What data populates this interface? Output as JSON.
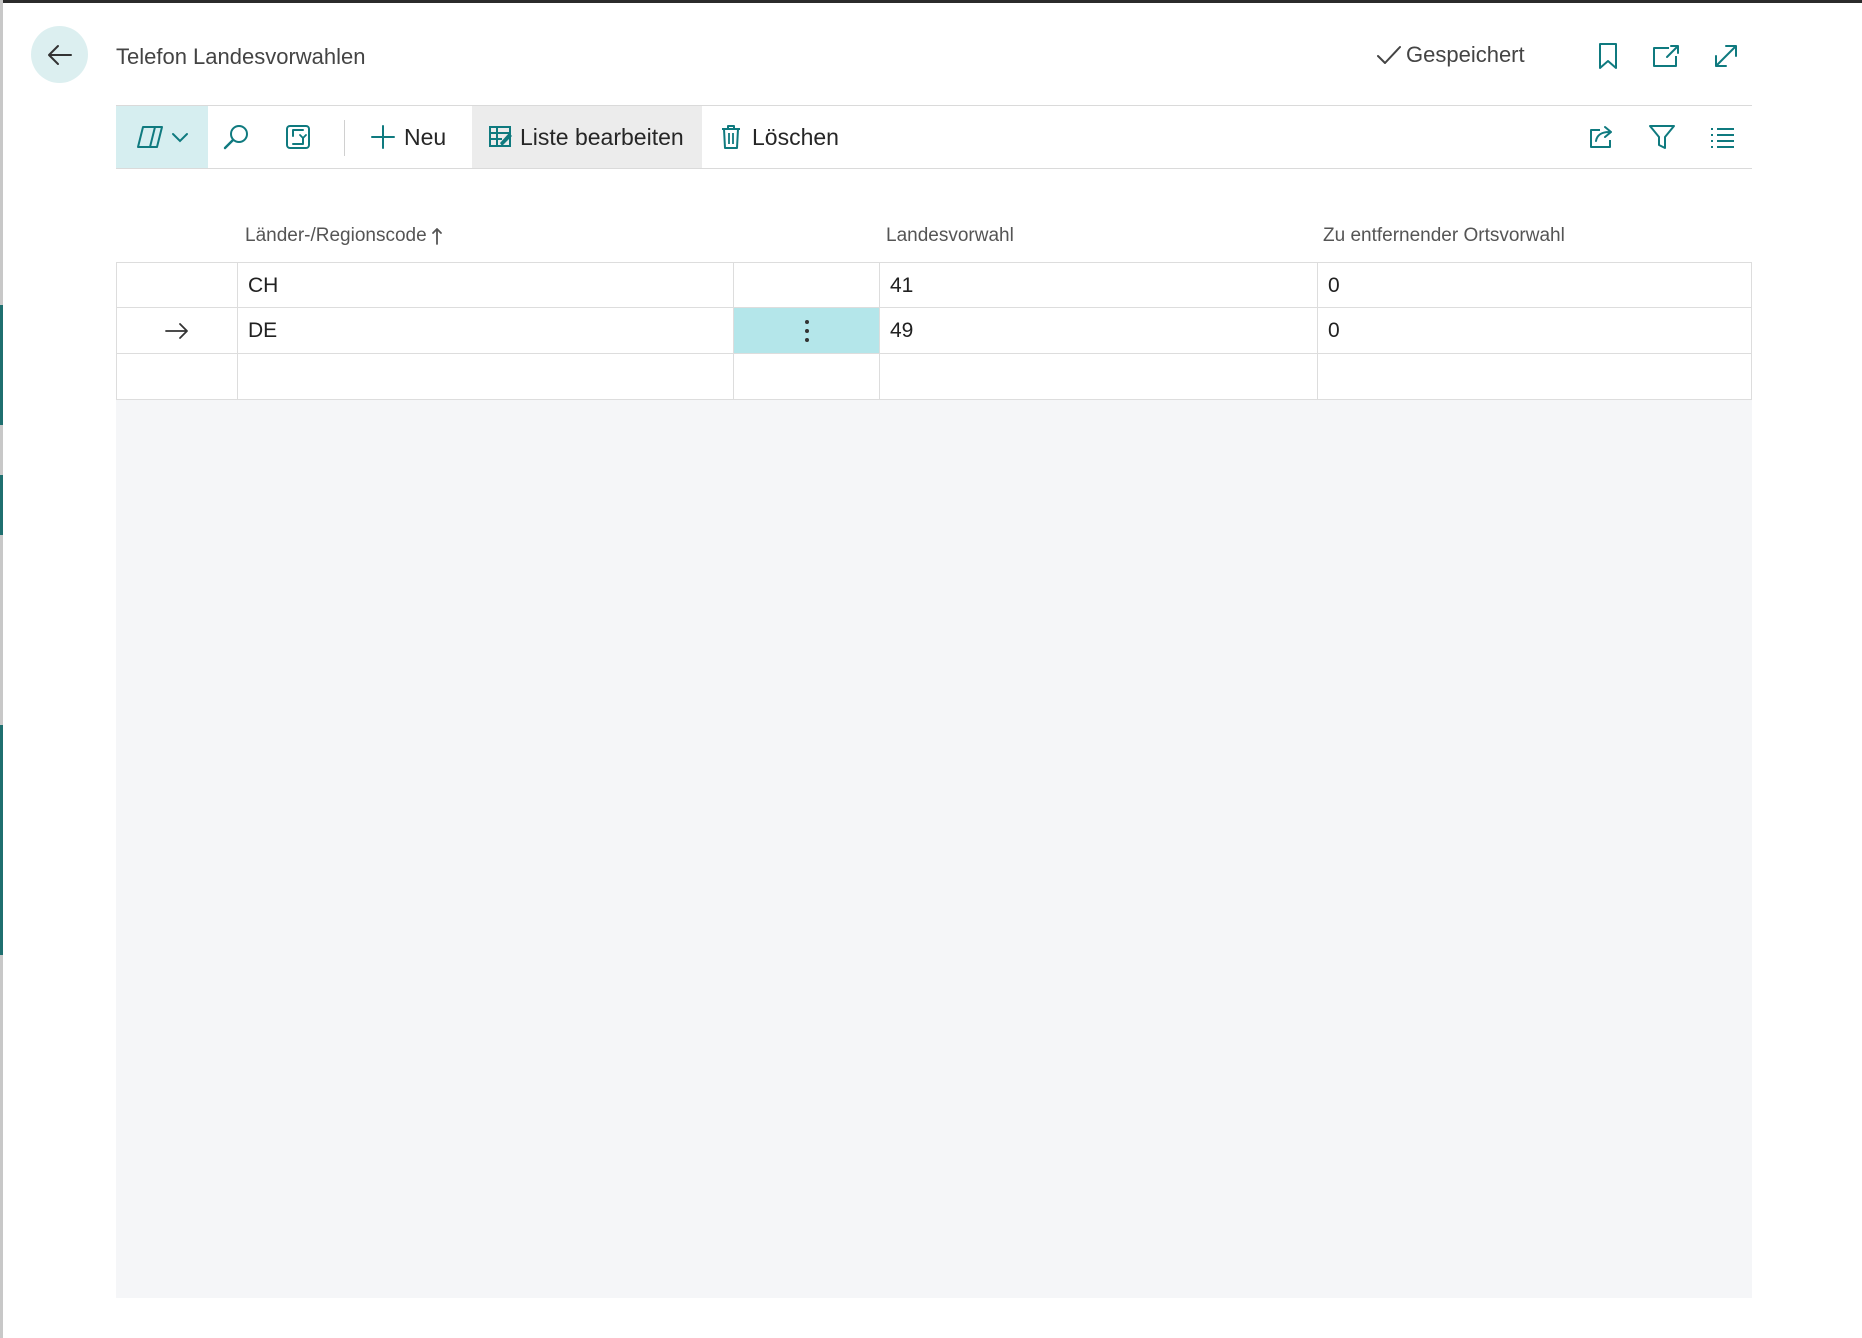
{
  "header": {
    "title": "Telefon Landesvorwahlen",
    "save_status": "Gespeichert"
  },
  "toolbar": {
    "new_label": "Neu",
    "edit_list_label": "Liste bearbeiten",
    "delete_label": "Löschen"
  },
  "table": {
    "columns": {
      "country_code": "Länder-/Regionscode",
      "country_prefix": "Landesvorwahl",
      "area_code_remove": "Zu entfernender Ortsvorwahl"
    },
    "rows": [
      {
        "country_code": "CH",
        "country_prefix": "41",
        "area_code_remove": "0"
      },
      {
        "country_code": "DE",
        "country_prefix": "49",
        "area_code_remove": "0"
      }
    ]
  },
  "colors": {
    "accent": "#0f7a7f",
    "selected_cell": "#b4e6ea",
    "back_button_bg": "#dceff0",
    "grid_background": "#f5f6f8"
  }
}
